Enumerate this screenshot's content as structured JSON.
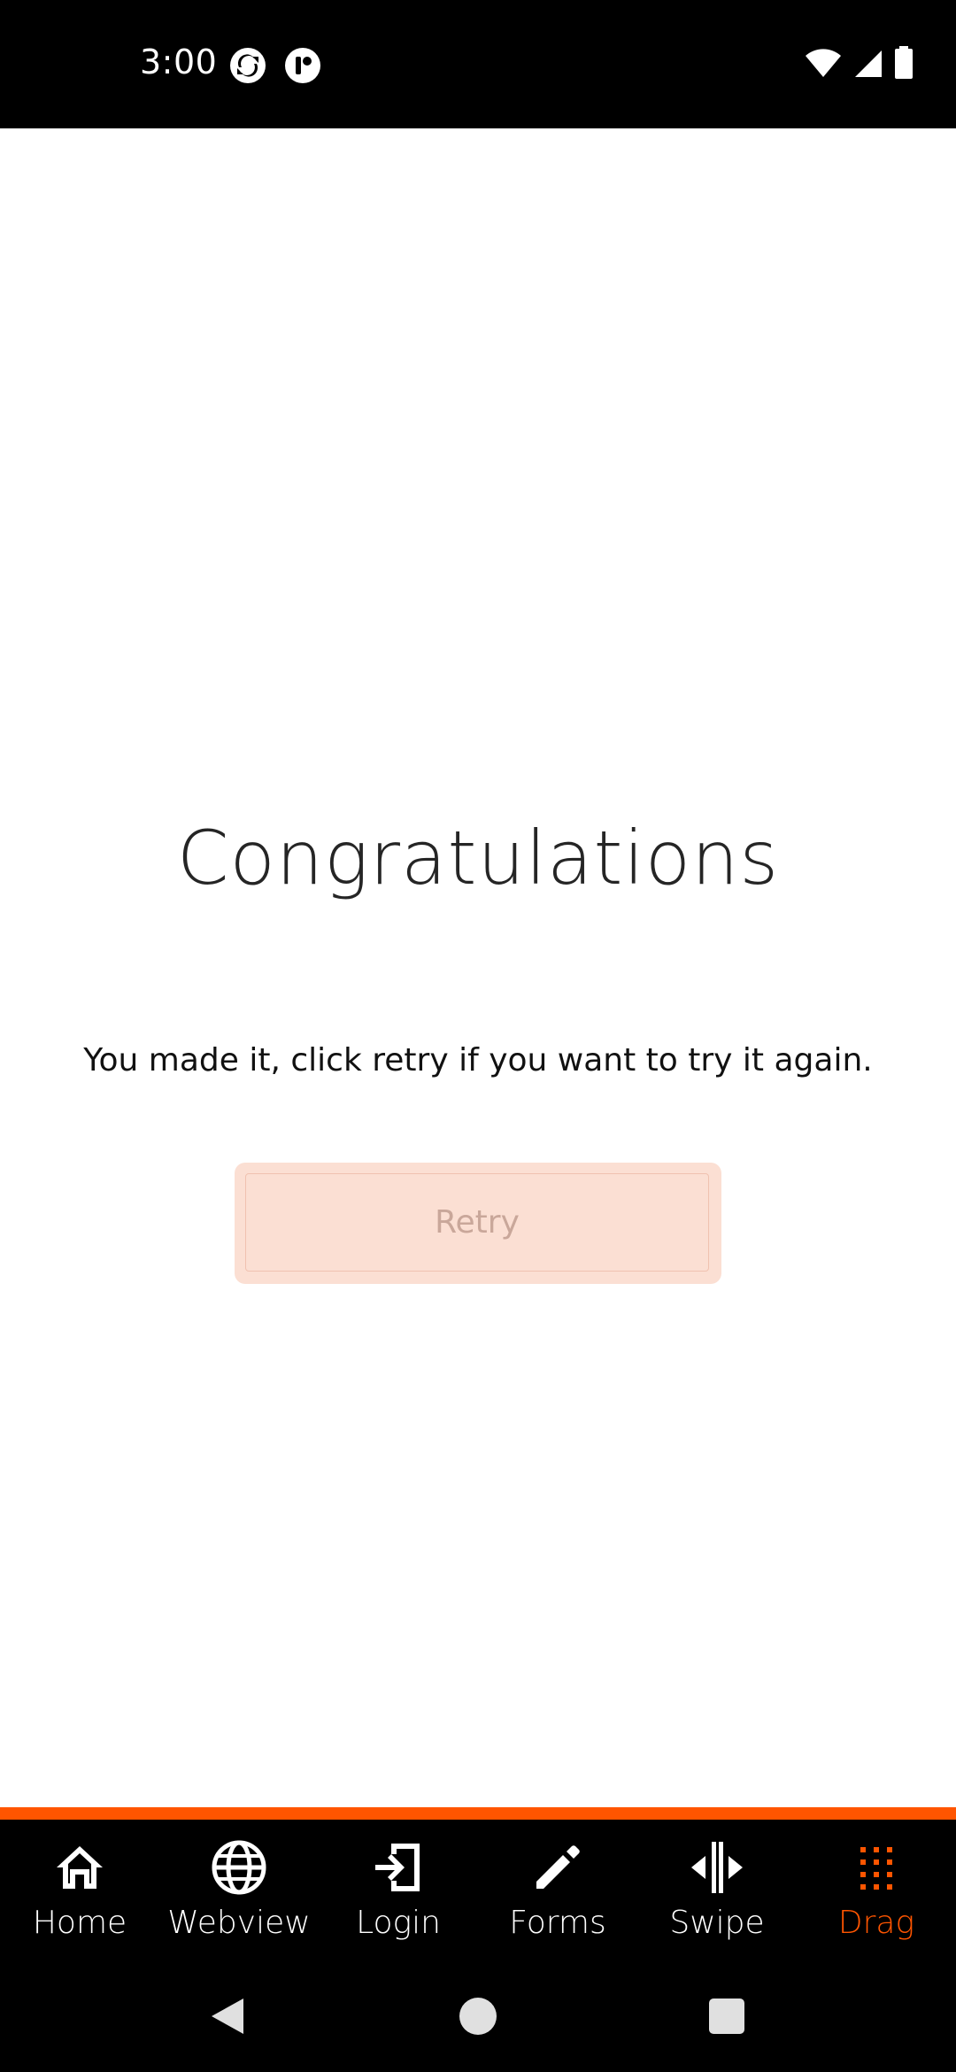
{
  "status_bar": {
    "time": "3:00",
    "left_icons": [
      "sync-app-icon",
      "notification-app-icon"
    ],
    "right_icons": [
      "wifi-icon",
      "cell-signal-icon",
      "battery-icon"
    ]
  },
  "main": {
    "title": "Congratulations",
    "message": "You made it, click retry if you want to try it again.",
    "retry_label": "Retry"
  },
  "tabs": [
    {
      "label": "Home",
      "icon": "home-icon",
      "active": false
    },
    {
      "label": "Webview",
      "icon": "globe-icon",
      "active": false
    },
    {
      "label": "Login",
      "icon": "login-icon",
      "active": false
    },
    {
      "label": "Forms",
      "icon": "pencil-icon",
      "active": false
    },
    {
      "label": "Swipe",
      "icon": "swipe-icon",
      "active": false
    },
    {
      "label": "Drag",
      "icon": "grid-dots-icon",
      "active": true
    }
  ],
  "colors": {
    "accent": "#ff5500",
    "retry_background": "#fbdfd3",
    "retry_text": "#c9a79a",
    "bar_background": "#000000"
  }
}
